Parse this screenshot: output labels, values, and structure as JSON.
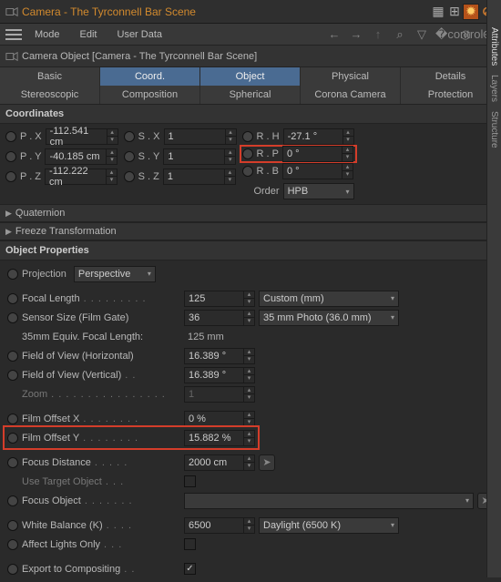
{
  "titlebar": {
    "title": "Camera - The Tyrconnell Bar Scene"
  },
  "menubar": {
    "mode": "Mode",
    "edit": "Edit",
    "userdata": "User Data"
  },
  "object_header": "Camera Object [Camera - The Tyrconnell Bar Scene]",
  "tabs_row1": [
    "Basic",
    "Coord.",
    "Object",
    "Physical",
    "Details"
  ],
  "tabs_row2": [
    "Stereoscopic",
    "Composition",
    "Spherical",
    "Corona Camera",
    "Protection"
  ],
  "coordinates": {
    "header": "Coordinates",
    "px_label": "P . X",
    "px": "-112.541 cm",
    "py_label": "P . Y",
    "py": "-40.185 cm",
    "pz_label": "P . Z",
    "pz": "-112.222 cm",
    "sx_label": "S . X",
    "sx": "1",
    "sy_label": "S . Y",
    "sy": "1",
    "sz_label": "S . Z",
    "sz": "1",
    "rh_label": "R . H",
    "rh": "-27.1 °",
    "rp_label": "R . P",
    "rp": "0 °",
    "rb_label": "R . B",
    "rb": "0 °",
    "order_label": "Order",
    "order": "HPB"
  },
  "quaternion": "Quaternion",
  "freeze": "Freeze Transformation",
  "props": {
    "header": "Object Properties",
    "projection_label": "Projection",
    "projection": "Perspective",
    "focal_label": "Focal Length",
    "focal": "125",
    "focal_preset": "Custom (mm)",
    "sensor_label": "Sensor Size (Film Gate)",
    "sensor": "36",
    "sensor_preset": "35 mm Photo (36.0 mm)",
    "equiv_label": "35mm Equiv. Focal Length:",
    "equiv": "125 mm",
    "fovh_label": "Field of View (Horizontal)",
    "fovh": "16.389 °",
    "fovv_label": "Field of View (Vertical)",
    "fovv": "16.389 °",
    "zoom_label": "Zoom",
    "zoom": "1",
    "offx_label": "Film Offset X",
    "offx": "0 %",
    "offy_label": "Film Offset Y",
    "offy": "15.882 %",
    "focusd_label": "Focus Distance",
    "focusd": "2000 cm",
    "usetarget_label": "Use Target Object",
    "focusobj_label": "Focus Object",
    "wb_label": "White Balance (K)",
    "wb": "6500",
    "wb_preset": "Daylight (6500 K)",
    "affect_label": "Affect Lights Only",
    "export_label": "Export to Compositing"
  },
  "sidetabs": [
    "Attributes",
    "Layers",
    "Structure"
  ]
}
